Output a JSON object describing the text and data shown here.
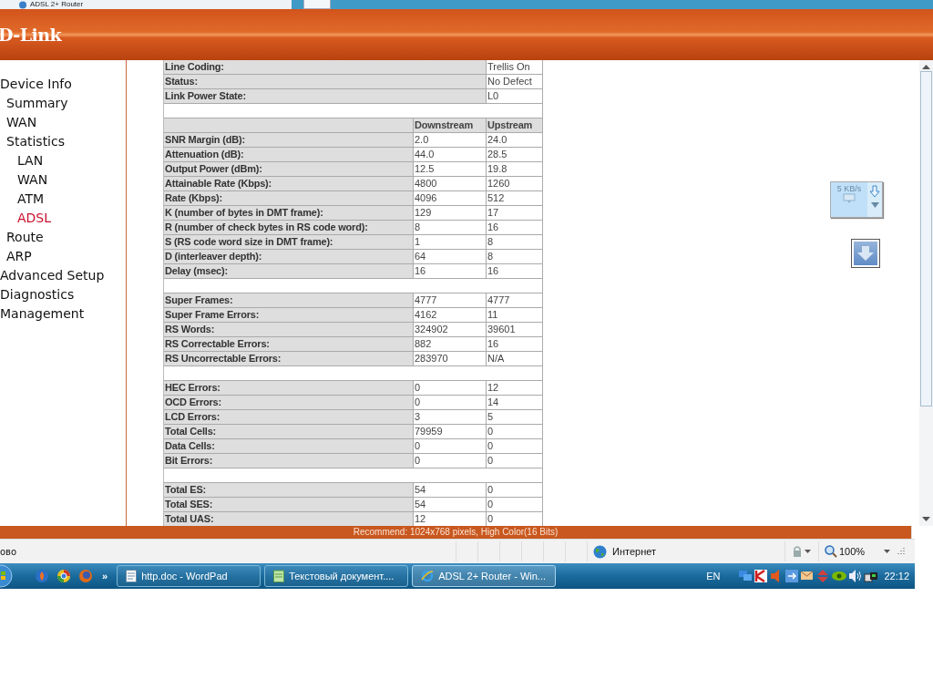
{
  "browser_tab": {
    "title": "ADSL 2+ Router"
  },
  "header": {
    "logo": "D-Link"
  },
  "sidebar": {
    "items": [
      {
        "label": "Device Info",
        "selected": false,
        "children": [
          {
            "label": "Summary",
            "selected": false
          },
          {
            "label": "WAN",
            "selected": false
          },
          {
            "label": "Statistics",
            "selected": false,
            "children": [
              {
                "label": "LAN",
                "selected": false
              },
              {
                "label": "WAN",
                "selected": false
              },
              {
                "label": "ATM",
                "selected": false
              },
              {
                "label": "ADSL",
                "selected": true
              }
            ]
          },
          {
            "label": "Route",
            "selected": false
          },
          {
            "label": "ARP",
            "selected": false
          }
        ]
      },
      {
        "label": "Advanced Setup",
        "selected": false
      },
      {
        "label": "Diagnostics",
        "selected": false
      },
      {
        "label": "Management",
        "selected": false
      }
    ]
  },
  "table": {
    "rows": [
      {
        "kind": "pair",
        "label": "Line Coding:",
        "value": "Trellis On"
      },
      {
        "kind": "pair",
        "label": "Status:",
        "value": "No Defect"
      },
      {
        "kind": "pair",
        "label": "Link Power State:",
        "value": "L0"
      },
      {
        "kind": "blank"
      },
      {
        "kind": "header",
        "downstream": "Downstream",
        "upstream": "Upstream"
      },
      {
        "kind": "data",
        "label": "SNR Margin (dB):",
        "downstream": "2.0",
        "upstream": "24.0"
      },
      {
        "kind": "data",
        "label": "Attenuation (dB):",
        "downstream": "44.0",
        "upstream": "28.5"
      },
      {
        "kind": "data",
        "label": "Output Power (dBm):",
        "downstream": "12.5",
        "upstream": "19.8"
      },
      {
        "kind": "data",
        "label": "Attainable Rate (Kbps):",
        "downstream": "4800",
        "upstream": "1260"
      },
      {
        "kind": "data",
        "label": "Rate (Kbps):",
        "downstream": "4096",
        "upstream": "512"
      },
      {
        "kind": "data",
        "label": "K (number of bytes in DMT frame):",
        "downstream": "129",
        "upstream": "17"
      },
      {
        "kind": "data",
        "label": "R (number of check bytes in RS code word):",
        "downstream": "8",
        "upstream": "16"
      },
      {
        "kind": "data",
        "label": "S (RS code word size in DMT frame):",
        "downstream": "1",
        "upstream": "8"
      },
      {
        "kind": "data",
        "label": "D (interleaver depth):",
        "downstream": "64",
        "upstream": "8"
      },
      {
        "kind": "data",
        "label": "Delay (msec):",
        "downstream": "16",
        "upstream": "16"
      },
      {
        "kind": "blank"
      },
      {
        "kind": "data",
        "label": "Super Frames:",
        "downstream": "4777",
        "upstream": "4777"
      },
      {
        "kind": "data",
        "label": "Super Frame Errors:",
        "downstream": "4162",
        "upstream": "11"
      },
      {
        "kind": "data",
        "label": "RS Words:",
        "downstream": "324902",
        "upstream": "39601"
      },
      {
        "kind": "data",
        "label": "RS Correctable Errors:",
        "downstream": "882",
        "upstream": "16"
      },
      {
        "kind": "data",
        "label": "RS Uncorrectable Errors:",
        "downstream": "283970",
        "upstream": "N/A"
      },
      {
        "kind": "blank"
      },
      {
        "kind": "data",
        "label": "HEC Errors:",
        "downstream": "0",
        "upstream": "12"
      },
      {
        "kind": "data",
        "label": "OCD Errors:",
        "downstream": "0",
        "upstream": "14"
      },
      {
        "kind": "data",
        "label": "LCD Errors:",
        "downstream": "3",
        "upstream": "5"
      },
      {
        "kind": "data",
        "label": "Total Cells:",
        "downstream": "79959",
        "upstream": "0"
      },
      {
        "kind": "data",
        "label": "Data Cells:",
        "downstream": "0",
        "upstream": "0"
      },
      {
        "kind": "data",
        "label": "Bit Errors:",
        "downstream": "0",
        "upstream": "0"
      },
      {
        "kind": "blank"
      },
      {
        "kind": "data",
        "label": "Total ES:",
        "downstream": "54",
        "upstream": "0"
      },
      {
        "kind": "data",
        "label": "Total SES:",
        "downstream": "54",
        "upstream": "0"
      },
      {
        "kind": "data",
        "label": "Total UAS:",
        "downstream": "12",
        "upstream": "0"
      }
    ]
  },
  "speed_widget": {
    "reading": "5 KB/s"
  },
  "footer": {
    "text": "Recommend: 1024x768 pixels, High Color(16 Bits)"
  },
  "status_bar": {
    "status": "ово",
    "zone": "Интернет",
    "zoom": "100%"
  },
  "taskbar": {
    "more": "»",
    "tasks": [
      {
        "label": "http.doc - WordPad",
        "kind": "doc",
        "selected": false
      },
      {
        "label": "Текстовый документ....",
        "kind": "note",
        "selected": false
      },
      {
        "label": "ADSL 2+ Router - Win...",
        "kind": "browser",
        "selected": true
      }
    ],
    "language": "EN",
    "clock": "22:12"
  }
}
